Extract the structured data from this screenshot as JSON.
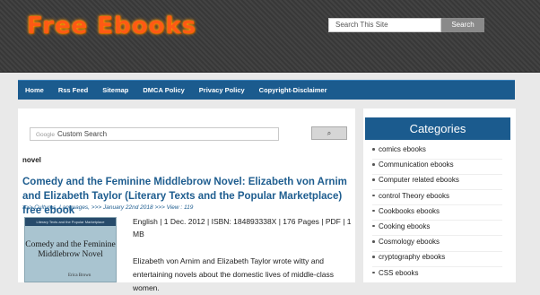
{
  "site": {
    "logo_text": "Free Ebooks"
  },
  "top_search": {
    "placeholder": "Search This Site",
    "button_label": "Search"
  },
  "nav": {
    "items": [
      "Home",
      "Rss Feed",
      "Sitemap",
      "DMCA Policy",
      "Privacy Policy",
      "Copyright-Disclaimer"
    ]
  },
  "google_search": {
    "brand": "Google",
    "placeholder": "Custom Search",
    "button_icon": "search-icon",
    "button_glyph": "⌕"
  },
  "main": {
    "tag": "novel",
    "post": {
      "title": "Comedy and the Feminine Middlebrow Novel: Elizabeth von Arnim and Elizabeth Taylor (Literary Texts and the Popular Marketplace) free ebook",
      "meta": ">>> Cultures, Languages, >>> January 22nd 2018 >>> View : 119",
      "details": "English | 1 Dec. 2012 | ISBN: 184893338X | 176 Pages | PDF | 1 MB",
      "description": "Elizabeth von Arnim and Elizabeth Taylor wrote witty and entertaining novels about the domestic lives of middle-class women.",
      "cover": {
        "series": "Literary Texts and the Popular Marketplace",
        "title": "Comedy and the Feminine Middlebrow Novel",
        "author": "Erica Brown"
      }
    }
  },
  "sidebar": {
    "heading": "Categories",
    "categories": [
      "comics ebooks",
      "Communication ebooks",
      "Computer related ebooks",
      "control Theory ebooks",
      "Cookbooks ebooks",
      "Cooking ebooks",
      "Cosmology ebooks",
      "cryptography ebooks",
      "CSS ebooks"
    ]
  },
  "colors": {
    "nav_bg": "#1b5b8e",
    "link": "#1e5d8f",
    "logo": "#ff5a14",
    "header_bg": "#3b3b3b"
  }
}
